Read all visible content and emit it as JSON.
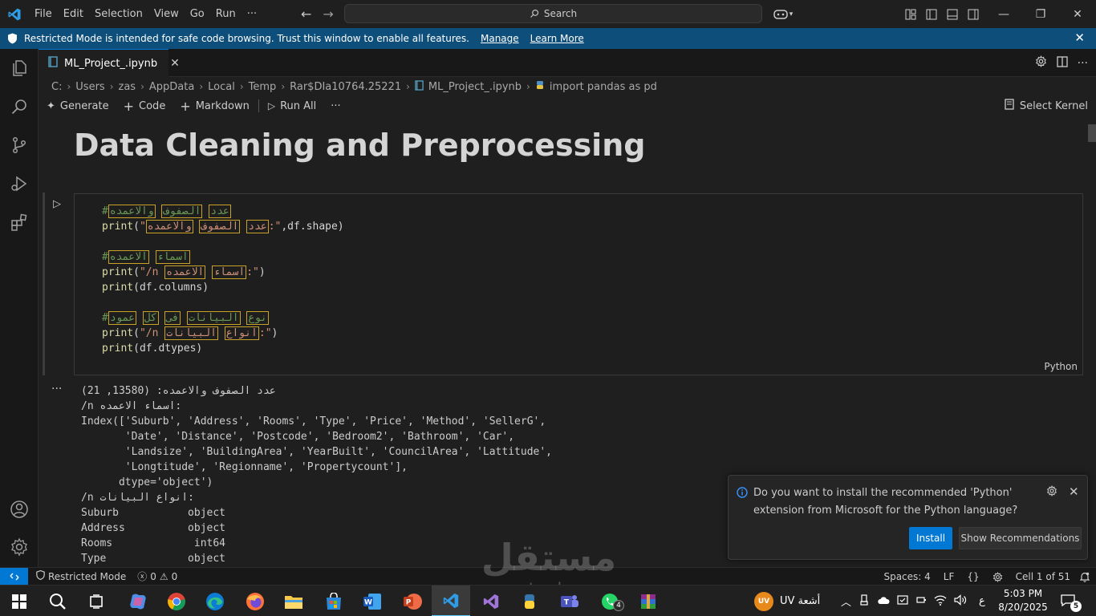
{
  "titlebar": {
    "menu": [
      "File",
      "Edit",
      "Selection",
      "View",
      "Go",
      "Run",
      "···"
    ],
    "search_label": "Search"
  },
  "banner": {
    "message": "Restricted Mode is intended for safe code browsing. Trust this window to enable all features.",
    "manage": "Manage",
    "learn_more": "Learn More"
  },
  "tab": {
    "title": "ML_Project_.ipynb"
  },
  "breadcrumb": [
    "C:",
    "Users",
    "zas",
    "AppData",
    "Local",
    "Temp",
    "Rar$DIa10764.25221",
    "ML_Project_.ipynb",
    "import pandas as pd"
  ],
  "toolbar": {
    "generate": "Generate",
    "code": "Code",
    "markdown": "Markdown",
    "run_all": "Run All",
    "more": "···",
    "select_kernel": "Select Kernel"
  },
  "markdown_title": "Data Cleaning and Preprocessing",
  "code_cell": {
    "language": "Python",
    "lines": [
      {
        "comment_hash": "#",
        "ar": [
          "عدد",
          "الصفوف",
          "والاعمده"
        ]
      },
      {
        "pre": "print(",
        "q": "\"",
        "ar": [
          "عدد",
          "الصفوف",
          "والاعمده"
        ],
        "post_str": ":\"",
        "tail": ",df.shape)"
      },
      {
        "blank": true
      },
      {
        "comment_hash": "#",
        "ar": [
          "اسماء",
          "الاعمده"
        ]
      },
      {
        "pre": "print(",
        "q": "\"/n ",
        "ar": [
          "اسماء",
          "الاعمده"
        ],
        "post_str": ":\"",
        "tail": ")"
      },
      {
        "plain": "print(df.columns)"
      },
      {
        "blank": true
      },
      {
        "comment_hash": "#",
        "ar": [
          "نوع",
          "البيانات",
          "فى",
          "كل",
          "عمود"
        ]
      },
      {
        "pre": "print(",
        "q": "\"/n ",
        "ar": [
          "انواع",
          "البيانات"
        ],
        "post_str": ":\"",
        "tail": ")"
      },
      {
        "plain": "print(df.dtypes)"
      }
    ]
  },
  "output": {
    "more": "···",
    "lines": [
      "عدد الصفوف والاعمده: (13580, 21)",
      "/n اسماء الاعمده:",
      "Index(['Suburb', 'Address', 'Rooms', 'Type', 'Price', 'Method', 'SellerG',",
      "       'Date', 'Distance', 'Postcode', 'Bedroom2', 'Bathroom', 'Car',",
      "       'Landsize', 'BuildingArea', 'YearBuilt', 'CouncilArea', 'Lattitude',",
      "       'Longtitude', 'Regionname', 'Propertycount'],",
      "      dtype='object')",
      "/n انواع البيانات:",
      "Suburb           object",
      "Address          object",
      "Rooms             int64",
      "Type             object"
    ]
  },
  "notification": {
    "message": "Do you want to install the recommended 'Python' extension from Microsoft for the Python language?",
    "install": "Install",
    "show_recommendations": "Show Recommendations"
  },
  "statusbar": {
    "restricted_mode": "Restricted Mode",
    "errors": "0",
    "warnings": "0",
    "spaces": "Spaces: 4",
    "eol": "LF",
    "braces": "{}",
    "cell_position": "Cell 1 of 51"
  },
  "watermark": {
    "main": "مستقل",
    "sub": "mostaql.com"
  },
  "taskbar": {
    "weather_badge": "UV",
    "weather_text": "UV أشعة",
    "lang": "ع",
    "time": "5:03 PM",
    "date": "8/20/2025",
    "notif_count": "5",
    "whatsapp_badge": "4"
  },
  "colors": {
    "accent": "#0078d4",
    "banner": "#0e4e7a",
    "comment": "#6a9955",
    "function": "#dcdcaa",
    "string": "#ce9178"
  }
}
